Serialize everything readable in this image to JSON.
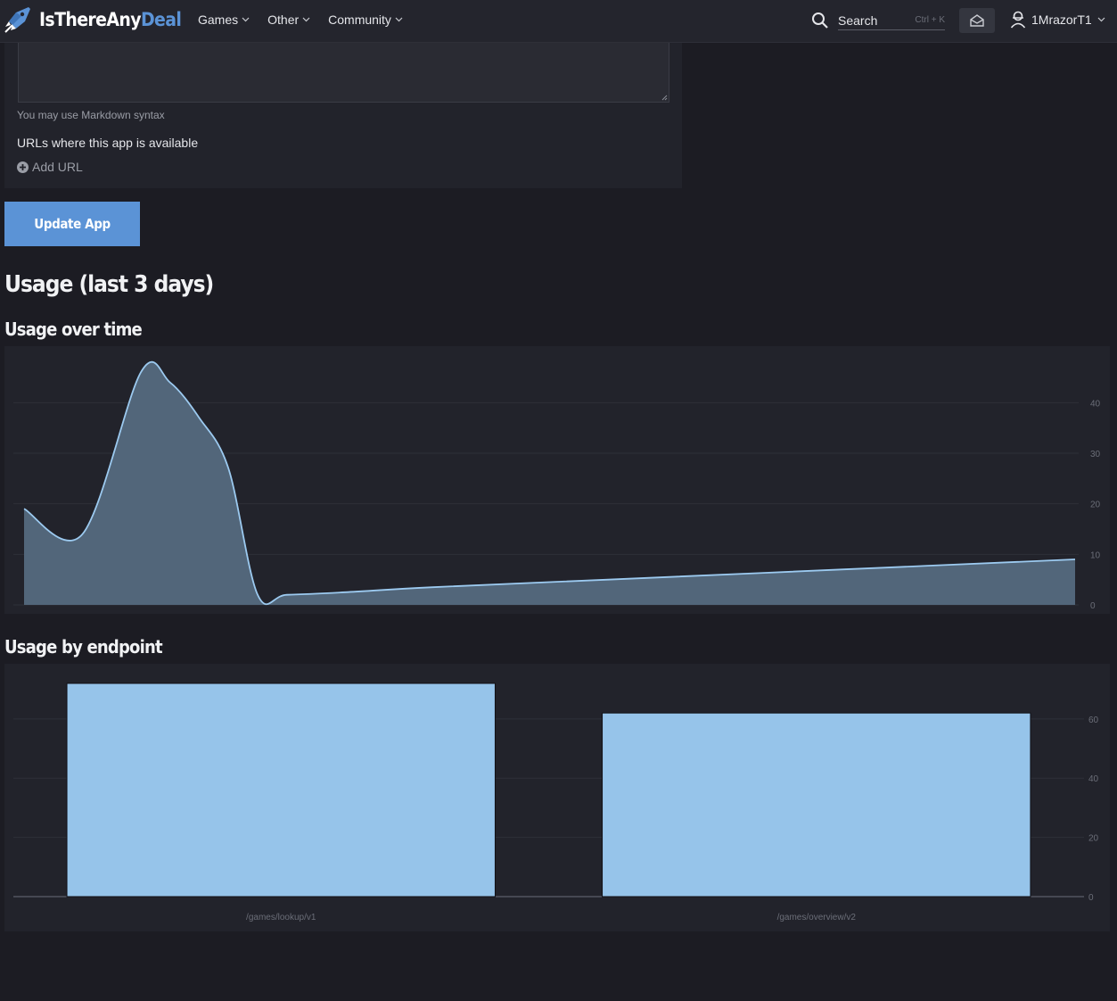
{
  "nav": {
    "logo_main": "IsThereAny",
    "logo_accent": "Deal",
    "items": [
      {
        "label": "Games"
      },
      {
        "label": "Other"
      },
      {
        "label": "Community"
      }
    ],
    "search_label": "Search",
    "search_shortcut": "Ctrl + K",
    "username": "1MrazorT1"
  },
  "form": {
    "markdown_hint": "You may use Markdown syntax",
    "urls_label": "URLs where this app is available",
    "add_url_label": "Add URL",
    "submit_label": "Update App"
  },
  "headings": {
    "usage_title": "Usage (last 3 days)",
    "over_time_title": "Usage over time",
    "by_endpoint_title": "Usage by endpoint"
  },
  "colors": {
    "accent": "#5b93d6",
    "area_fill": "#52667a",
    "line": "#9ccaf0",
    "bar_fill": "#96c4ea",
    "panel_bg": "#22232b",
    "page_bg": "#1c1c23"
  },
  "chart_data": [
    {
      "type": "area",
      "title": "Usage over time",
      "xlabel": "",
      "ylabel": "",
      "x": [
        0,
        2,
        4,
        5,
        6,
        7,
        8,
        9,
        11,
        14,
        20,
        28,
        36
      ],
      "y": [
        19,
        14,
        46,
        44,
        37,
        27,
        2,
        2,
        2.5,
        3.5,
        5,
        7,
        9
      ],
      "x_ticks_visible": false,
      "y_ticks": [
        0,
        10,
        20,
        30,
        40
      ],
      "ylim": [
        0,
        48
      ],
      "grid": true,
      "y_axis_side": "right",
      "smooth": true
    },
    {
      "type": "bar",
      "title": "Usage by endpoint",
      "xlabel": "",
      "ylabel": "",
      "categories": [
        "/games/lookup/v1",
        "/games/overview/v2"
      ],
      "values": [
        72,
        62
      ],
      "y_ticks": [
        0,
        20,
        40,
        60
      ],
      "ylim": [
        0,
        72
      ],
      "grid": true,
      "y_axis_side": "right"
    }
  ]
}
